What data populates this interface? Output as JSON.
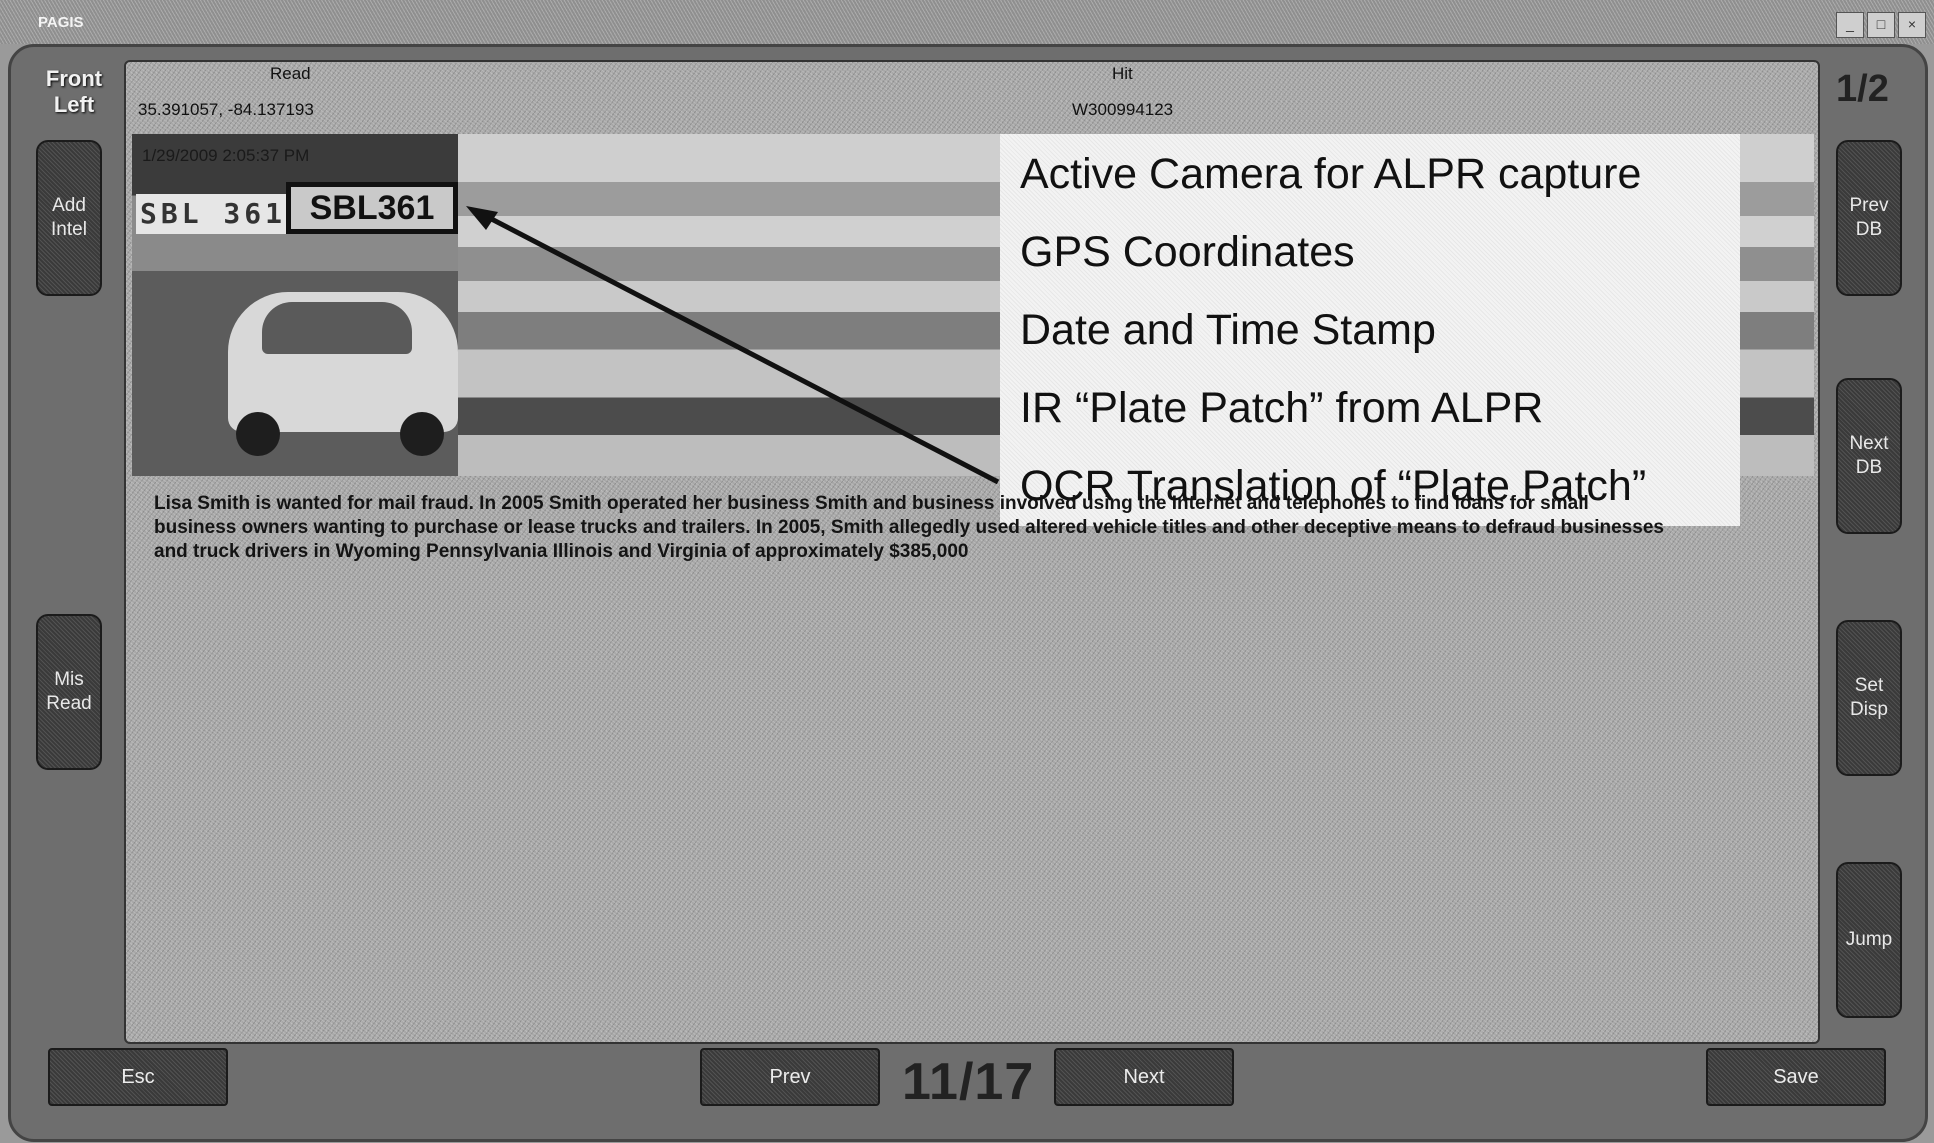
{
  "window": {
    "title": "PAGIS",
    "controls": [
      "_",
      "□",
      "×"
    ]
  },
  "camera": {
    "label_line1": "Front",
    "label_line2": "Left"
  },
  "read": {
    "label": "Read",
    "coords": "35.391057, -84.137193",
    "timestamp": "1/29/2009 2:05:37 PM"
  },
  "hit": {
    "label": "Hit",
    "id": "W300994123"
  },
  "page_indicator": "1/2",
  "plate": {
    "raw_patch": "SBL 361",
    "ocr_text": "SBL361"
  },
  "annotations": [
    "Active Camera for ALPR capture",
    "GPS Coordinates",
    "Date and Time Stamp",
    "IR  “Plate Patch” from ALPR",
    "OCR Translation of  “Plate Patch”"
  ],
  "bio_text": "Lisa Smith is wanted for mail fraud. In 2005 Smith operated her business Smith and business involved using the Internet and telephones to find loans for small business owners wanting to purchase or lease trucks and trailers. In 2005, Smith allegedly used altered vehicle titles and other deceptive means to defraud businesses and truck drivers in Wyoming Pennsylvania Illinois and Virginia of approximately $385,000",
  "left_buttons": {
    "add_intel": "Add\nIntel",
    "mis_read": "Mis\nRead"
  },
  "right_buttons": {
    "prev_db": "Prev\nDB",
    "next_db": "Next\nDB",
    "set_disp": "Set\nDisp",
    "jump": "Jump"
  },
  "bottom": {
    "esc": "Esc",
    "prev": "Prev",
    "counter": "11/17",
    "next": "Next",
    "save": "Save"
  }
}
